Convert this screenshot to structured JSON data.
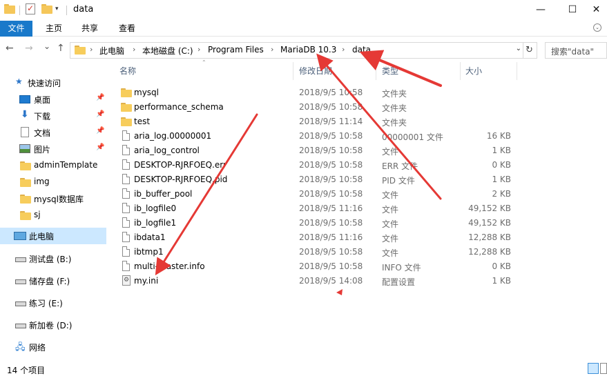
{
  "window": {
    "title": "data",
    "controls": {
      "minimize": "—",
      "maximize": "☐",
      "close": "✕"
    }
  },
  "ribbon": {
    "tabs": [
      {
        "label": "文件",
        "active": true
      },
      {
        "label": "主页",
        "active": false
      },
      {
        "label": "共享",
        "active": false
      },
      {
        "label": "查看",
        "active": false
      }
    ]
  },
  "nav": {
    "back": "←",
    "forward": "→",
    "recent": "⌄",
    "up": "↑",
    "breadcrumbs": [
      "此电脑",
      "本地磁盘 (C:)",
      "Program Files",
      "MariaDB 10.3",
      "data"
    ],
    "refresh": "↻",
    "search_placeholder": "搜索\"data\""
  },
  "sidebar": {
    "items": [
      {
        "label": "快速访问",
        "icon": "star-icon"
      },
      {
        "label": "桌面",
        "icon": "desktop-icon",
        "pinned": true
      },
      {
        "label": "下载",
        "icon": "download-icon",
        "pinned": true
      },
      {
        "label": "文档",
        "icon": "document-icon",
        "pinned": true
      },
      {
        "label": "图片",
        "icon": "pictures-icon",
        "pinned": true
      },
      {
        "label": "adminTemplate",
        "icon": "folder-icon"
      },
      {
        "label": "img",
        "icon": "folder-icon"
      },
      {
        "label": "mysql数据库",
        "icon": "folder-icon"
      },
      {
        "label": "sj",
        "icon": "folder-icon"
      },
      {
        "label": "此电脑",
        "icon": "this-pc-icon",
        "selected": true
      },
      {
        "label": "测试盘 (B:)",
        "icon": "drive-icon"
      },
      {
        "label": "储存盘 (F:)",
        "icon": "drive-icon"
      },
      {
        "label": "练习 (E:)",
        "icon": "drive-icon"
      },
      {
        "label": "新加卷 (D:)",
        "icon": "drive-icon"
      },
      {
        "label": "网络",
        "icon": "network-icon"
      }
    ]
  },
  "columns": {
    "name": "名称",
    "date": "修改日期",
    "type": "类型",
    "size": "大小"
  },
  "files": [
    {
      "name": "mysql",
      "date": "2018/9/5 10:58",
      "type": "文件夹",
      "size": "",
      "kind": "folder"
    },
    {
      "name": "performance_schema",
      "date": "2018/9/5 10:58",
      "type": "文件夹",
      "size": "",
      "kind": "folder"
    },
    {
      "name": "test",
      "date": "2018/9/5 11:14",
      "type": "文件夹",
      "size": "",
      "kind": "folder"
    },
    {
      "name": "aria_log.00000001",
      "date": "2018/9/5 10:58",
      "type": "00000001 文件",
      "size": "16 KB",
      "kind": "file"
    },
    {
      "name": "aria_log_control",
      "date": "2018/9/5 10:58",
      "type": "文件",
      "size": "1 KB",
      "kind": "file"
    },
    {
      "name": "DESKTOP-RJRFOEQ.err",
      "date": "2018/9/5 10:58",
      "type": "ERR 文件",
      "size": "0 KB",
      "kind": "file"
    },
    {
      "name": "DESKTOP-RJRFOEQ.pid",
      "date": "2018/9/5 10:58",
      "type": "PID 文件",
      "size": "1 KB",
      "kind": "file"
    },
    {
      "name": "ib_buffer_pool",
      "date": "2018/9/5 10:58",
      "type": "文件",
      "size": "2 KB",
      "kind": "file"
    },
    {
      "name": "ib_logfile0",
      "date": "2018/9/5 11:16",
      "type": "文件",
      "size": "49,152 KB",
      "kind": "file"
    },
    {
      "name": "ib_logfile1",
      "date": "2018/9/5 10:58",
      "type": "文件",
      "size": "49,152 KB",
      "kind": "file"
    },
    {
      "name": "ibdata1",
      "date": "2018/9/5 11:16",
      "type": "文件",
      "size": "12,288 KB",
      "kind": "file"
    },
    {
      "name": "ibtmp1",
      "date": "2018/9/5 10:58",
      "type": "文件",
      "size": "12,288 KB",
      "kind": "file"
    },
    {
      "name": "multi-master.info",
      "date": "2018/9/5 10:58",
      "type": "INFO 文件",
      "size": "0 KB",
      "kind": "file"
    },
    {
      "name": "my.ini",
      "date": "2018/9/5 14:08",
      "type": "配置设置",
      "size": "1 KB",
      "kind": "config"
    }
  ],
  "status": {
    "item_count": "14 个项目"
  },
  "colors": {
    "accent": "#1979ca",
    "selection": "#cce8ff",
    "annotation": "#e53935"
  }
}
